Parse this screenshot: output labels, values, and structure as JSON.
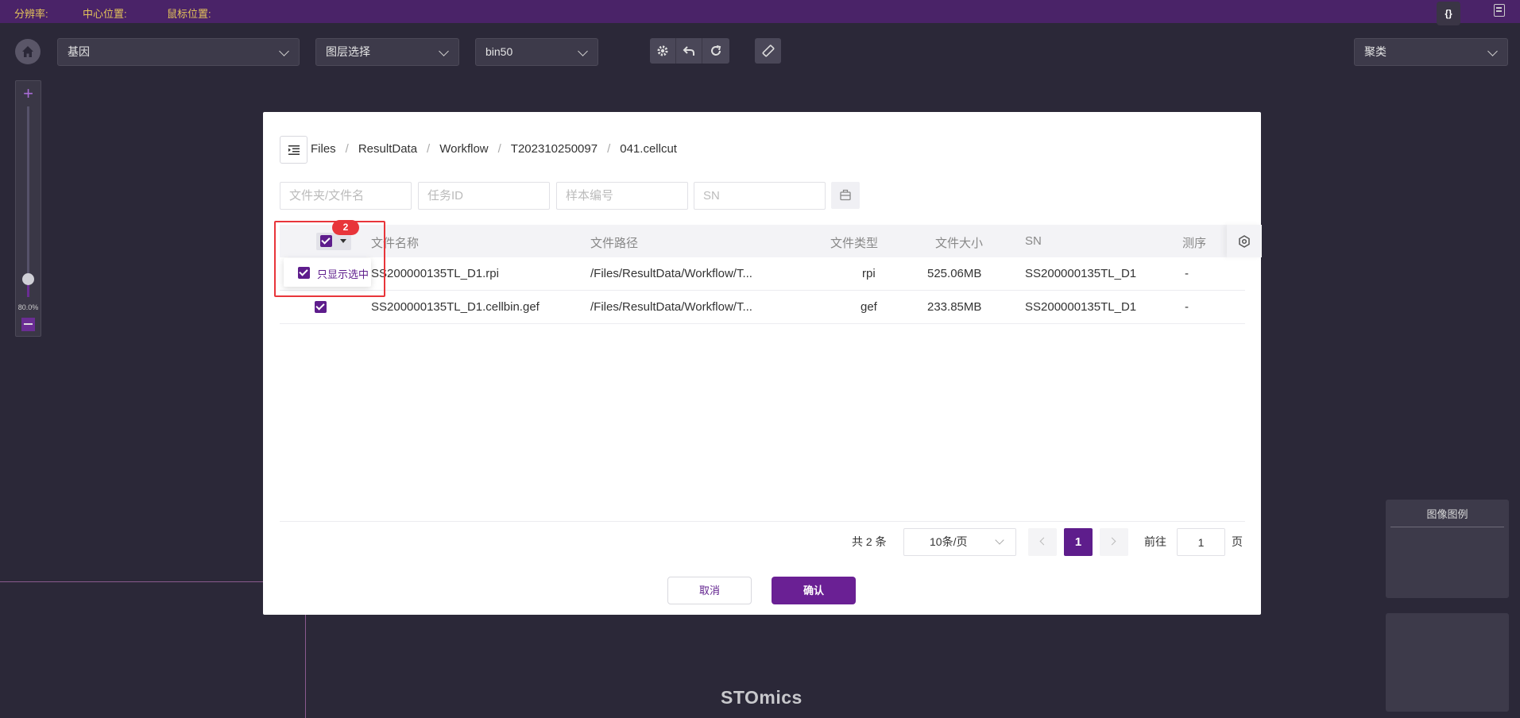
{
  "topbar": {
    "resolution_label": "分辨率:",
    "center_label": "中心位置:",
    "mouse_label": "鼠标位置:",
    "brace_btn": "{}"
  },
  "toolbar": {
    "gene_select": "基因",
    "layer_select": "图层选择",
    "bin_select": "bin50",
    "cluster_select": "聚类"
  },
  "zoom": {
    "percent_label": "80.0%",
    "level": 0.8
  },
  "legend_title": "图像图例",
  "brand": "STOmics",
  "modal": {
    "breadcrumb": [
      "Files",
      "ResultData",
      "Workflow",
      "T202310250097",
      "041.cellcut"
    ],
    "filters": {
      "folder_placeholder": "文件夹/文件名",
      "task_placeholder": "任务ID",
      "sample_placeholder": "样本编号",
      "sn_placeholder": "SN"
    },
    "columns": {
      "name": "文件名称",
      "path": "文件路径",
      "type": "文件类型",
      "size": "文件大小",
      "sn": "SN",
      "seq": "测序"
    },
    "rows": [
      {
        "name": "SS200000135TL_D1.rpi",
        "path": "/Files/ResultData/Workflow/T...",
        "type": "rpi",
        "size": "525.06MB",
        "sn": "SS200000135TL_D1",
        "seq": "-"
      },
      {
        "name": "SS200000135TL_D1.cellbin.gef",
        "path": "/Files/ResultData/Workflow/T...",
        "type": "gef",
        "size": "233.85MB",
        "sn": "SS200000135TL_D1",
        "seq": "-"
      }
    ],
    "selected_count": "2",
    "dropdown_option": "只显示选中",
    "pagination": {
      "total": "共 2 条",
      "page_size": "10条/页",
      "current_page": "1",
      "goto_label": "前往",
      "goto_value": "1",
      "page_suffix": "页"
    },
    "cancel_label": "取消",
    "confirm_label": "确认"
  }
}
